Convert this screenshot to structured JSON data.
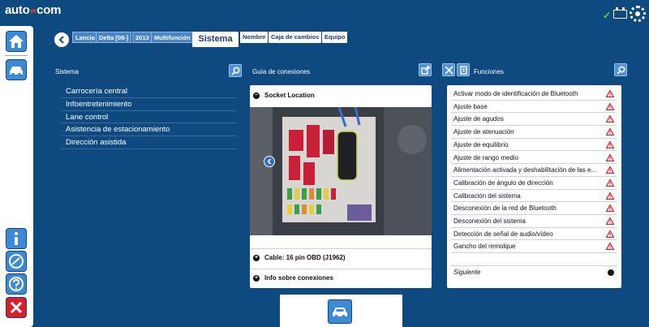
{
  "app": {
    "logo_left": "auto",
    "logo_mid": "w",
    "logo_right": "com"
  },
  "status": {
    "connection_icon": "check-icon",
    "battery_icon": "battery-icon",
    "settings_icon": "gear-icon"
  },
  "breadcrumb": {
    "items": [
      "Lancia",
      "Delta [08-]",
      "2013",
      "Multifunción"
    ],
    "current": "Sistema",
    "options": [
      "Nombre",
      "Caja de cambios",
      "Equipo"
    ]
  },
  "sistema": {
    "title": "Sistema",
    "items": [
      "Carrocería central",
      "Infoentretenimiento",
      "Lane control",
      "Asistencia de estacionamiento",
      "Dirección asistida"
    ]
  },
  "connections": {
    "title": "Guía de conexiones",
    "socket_location": "Socket Location",
    "cable": "Cable: 16 pin OBD (J1962)",
    "info": "Info sobre conexiones"
  },
  "functions": {
    "title": "Funciones",
    "items": [
      "Activar modo de identificación de Bluetooth",
      "Ajuste base",
      "Ajuste de agudos",
      "Ajuste de atenuación",
      "Ajuste de equilibrio",
      "Ajuste de rango medio",
      "Alimentación activada y deshabilitación de las e...",
      "Calibración de ángulo de dirección",
      "Calibración del sistema",
      "Desconexión de la red de Bluetooth",
      "Desconexión del sistema",
      "Detección de señal de audio/vídeo",
      "Gancho del remolque"
    ],
    "next": "Siguiente"
  },
  "colors": {
    "background": "#0e4a80",
    "accent": "#4f8fd4",
    "warning": "#d8202a"
  }
}
